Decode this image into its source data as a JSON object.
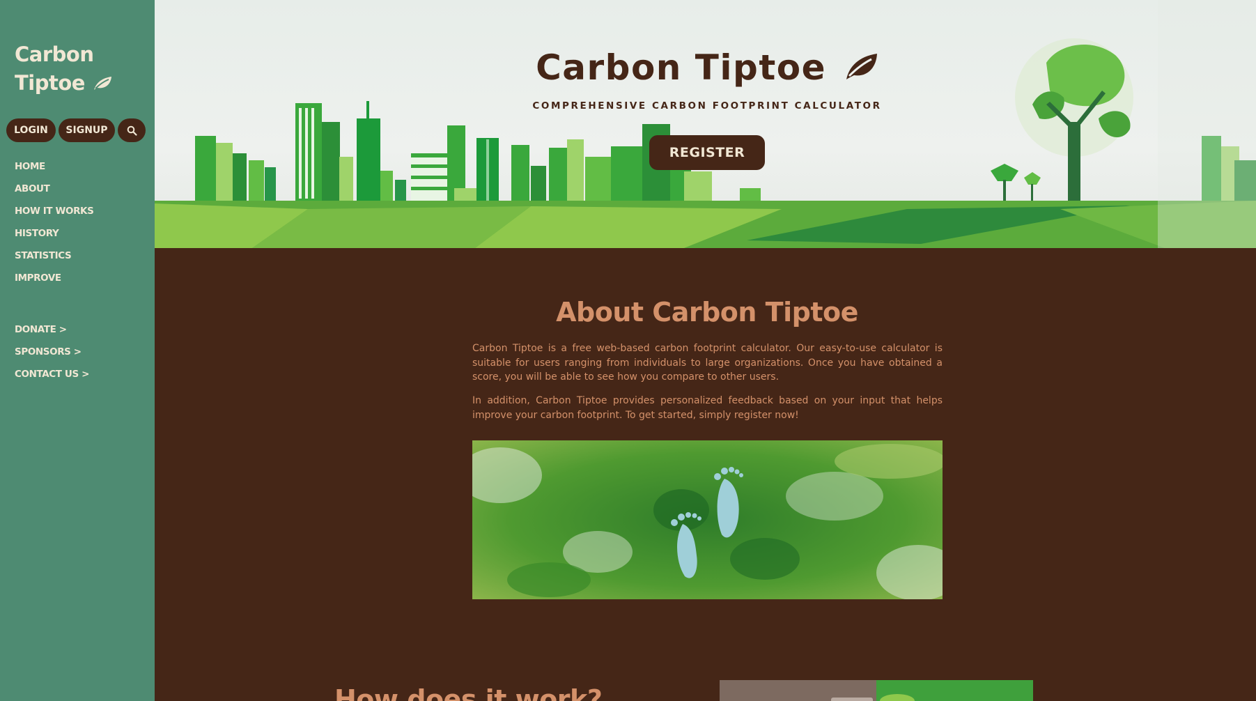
{
  "sidebar": {
    "logo_line1": "Carbon",
    "logo_line2": "Tiptoe",
    "login_label": "LOGIN",
    "signup_label": "SIGNUP",
    "nav_items": [
      "HOME",
      "ABOUT",
      "HOW IT WORKS",
      "HISTORY",
      "STATISTICS",
      "IMPROVE"
    ],
    "secondary_items": [
      "DONATE >",
      "SPONSORS >",
      "CONTACT US >"
    ]
  },
  "hero": {
    "title": "Carbon Tiptoe",
    "subtitle": "COMPREHENSIVE CARBON FOOTPRINT CALCULATOR",
    "register_label": "REGISTER"
  },
  "about": {
    "title": "About Carbon Tiptoe",
    "paragraph1": "Carbon Tiptoe is a free web-based carbon footprint calculator. Our easy-to-use calculator is suitable for users ranging from individuals to large organizations. Once you have obtained a score, you will be able to see how you compare to other users.",
    "paragraph2": "In addition, Carbon Tiptoe provides personalized feedback based on your input that helps improve your carbon footprint. To get started, simply register now!"
  },
  "how": {
    "title": "How does it work?"
  },
  "icons": {
    "leaf": "leaf-icon",
    "search": "search-icon"
  },
  "colors": {
    "sidebar": "#4e8b72",
    "brown": "#452617",
    "cream": "#f1e7d4",
    "accent": "#d4916a",
    "green": "#5cab3c"
  }
}
